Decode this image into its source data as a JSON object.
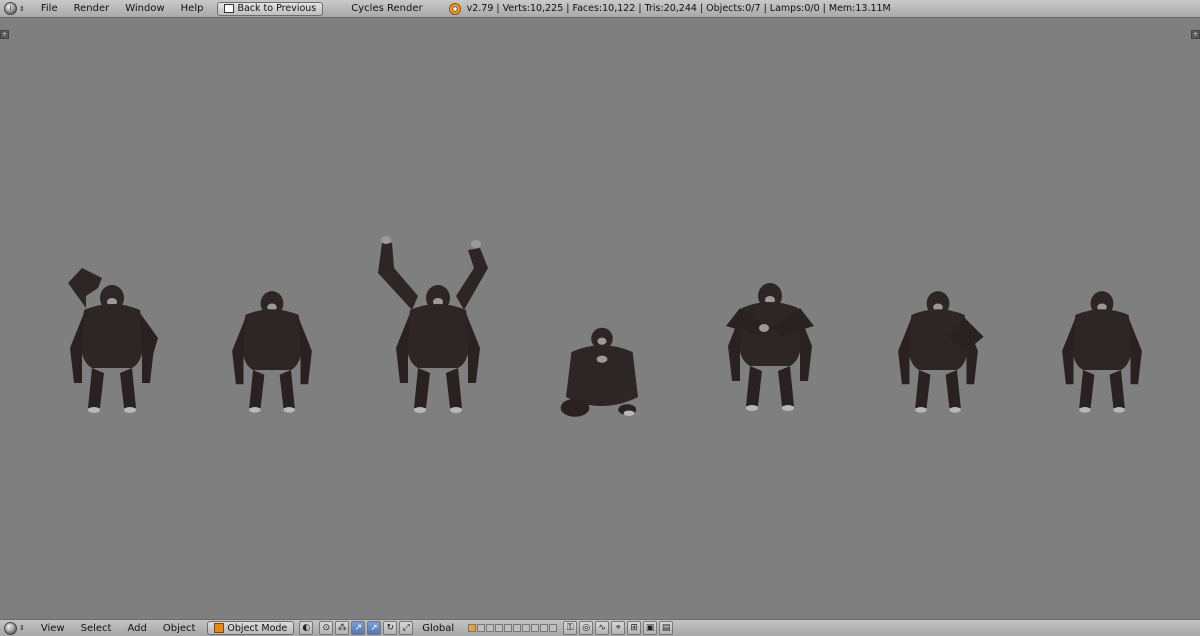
{
  "topbar": {
    "menu": [
      "File",
      "Render",
      "Window",
      "Help"
    ],
    "back_button": "Back to Previous",
    "engine": "Cycles Render",
    "stats": "v2.79 | Verts:10,225 | Faces:10,122 | Tris:20,244 | Objects:0/7 | Lamps:0/0 | Mem:13.11M"
  },
  "bottombar": {
    "menu": [
      "View",
      "Select",
      "Add",
      "Object"
    ],
    "mode": "Object Mode",
    "orientation": "Global"
  },
  "colors": {
    "viewport_bg": "#7f7f7f",
    "gorilla_body": "#2e2624",
    "gorilla_face": "#9a9a9a"
  },
  "icons": {
    "editor_type": "info-icon",
    "blender_logo": "blender-logo-icon",
    "object_mode": "cube-icon",
    "manipulator": "transform-manipulator-icon"
  }
}
